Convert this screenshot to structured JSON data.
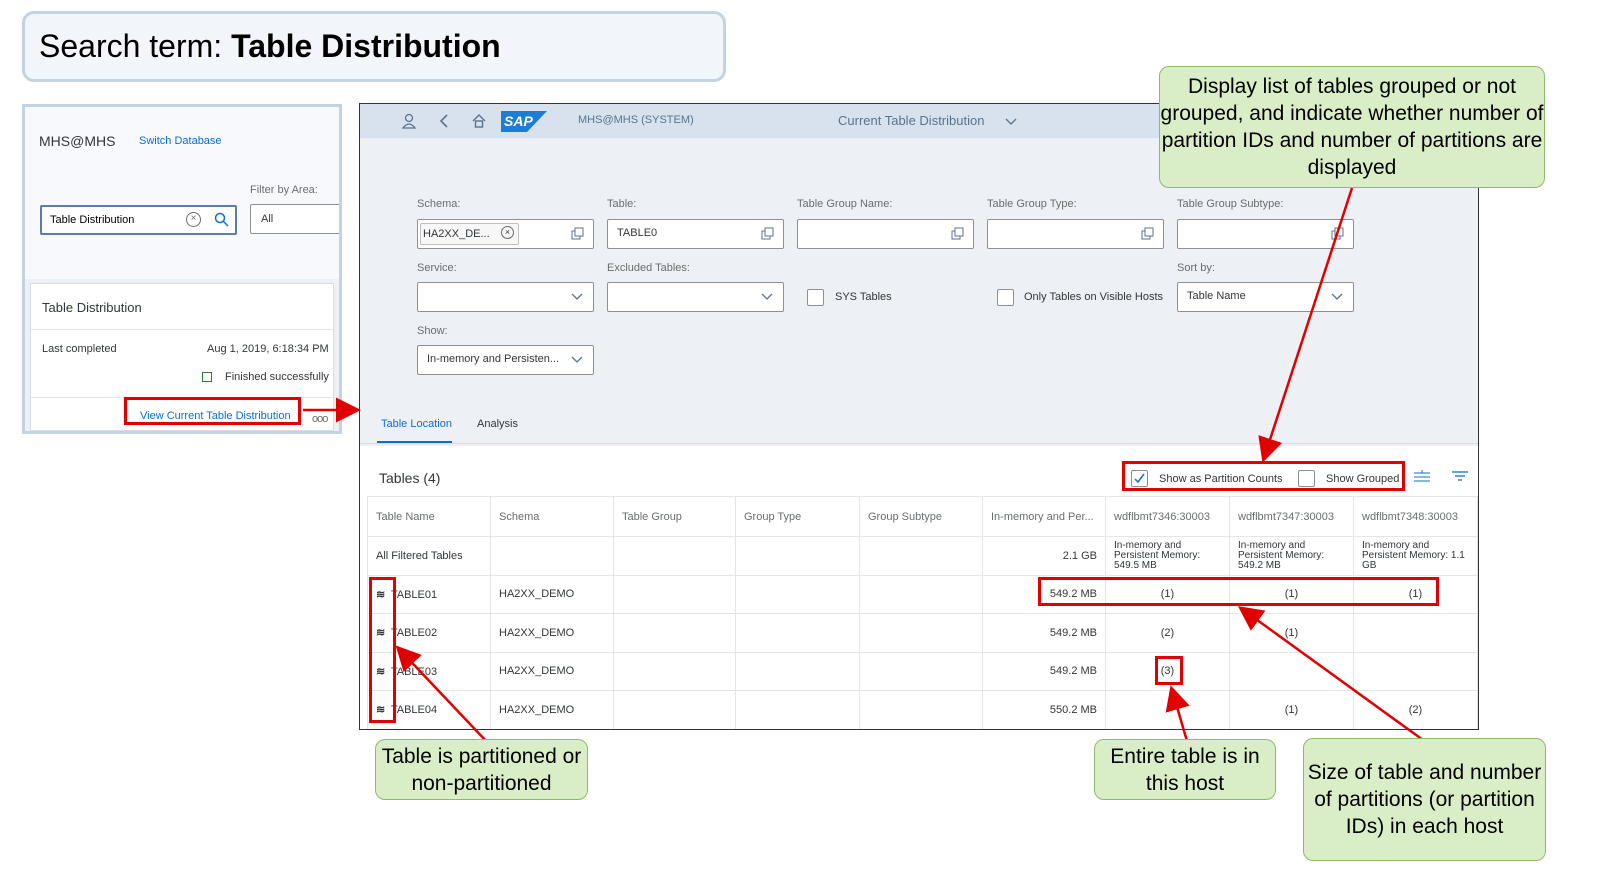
{
  "banner": {
    "prefix": "Search term:",
    "term": "Table Distribution"
  },
  "left_panel": {
    "db_name": "MHS@MHS",
    "switch_db": "Switch Database",
    "filter_label": "Filter by Area:",
    "search_value": "Table Distribution",
    "filter_value": "All",
    "card_title": "Table Distribution",
    "last_completed_label": "Last completed",
    "last_completed_value": "Aug 1, 2019, 6:18:34 PM",
    "status": "Finished successfully",
    "view_link": "View Current Table Distribution",
    "more": "ooo"
  },
  "shell": {
    "logo": "SAP",
    "system": "MHS@MHS (SYSTEM)",
    "title": "Current Table Distribution"
  },
  "filters": {
    "schema_label": "Schema:",
    "schema_token": "HA2XX_DE...",
    "table_label": "Table:",
    "table_value": "TABLE0",
    "group_name_label": "Table Group Name:",
    "group_type_label": "Table Group Type:",
    "group_subtype_label": "Table Group Subtype:",
    "service_label": "Service:",
    "excluded_label": "Excluded Tables:",
    "sys_tables": "SYS Tables",
    "only_visible": "Only Tables on Visible Hosts",
    "sort_label": "Sort by:",
    "sort_value": "Table Name",
    "show_label": "Show:",
    "show_value": "In-memory and Persisten..."
  },
  "tabs": [
    "Table Location",
    "Analysis"
  ],
  "table": {
    "title": "Tables (4)",
    "show_partition_counts": "Show as Partition Counts",
    "show_grouped": "Show Grouped",
    "columns": [
      "Table Name",
      "Schema",
      "Table Group",
      "Group Type",
      "Group Subtype",
      "In-memory and Per...",
      "wdflbmt7346:30003",
      "wdflbmt7347:30003",
      "wdflbmt7348:30003"
    ],
    "summary": {
      "name": "All Filtered Tables",
      "total": "2.1 GB",
      "host1": "In-memory and Persistent Memory: 549.5 MB",
      "host2": "In-memory and Persistent Memory: 549.2 MB",
      "host3": "In-memory and Persistent Memory: 1.1 GB"
    },
    "rows": [
      {
        "name": "TABLE01",
        "schema": "HA2XX_DEMO",
        "size": "549.2 MB",
        "h1": "(1)",
        "h2": "(1)",
        "h3": "(1)"
      },
      {
        "name": "TABLE02",
        "schema": "HA2XX_DEMO",
        "size": "549.2 MB",
        "h1": "(2)",
        "h2": "(1)",
        "h3": ""
      },
      {
        "name": "TABLE03",
        "schema": "HA2XX_DEMO",
        "size": "549.2 MB",
        "h1": "(3)",
        "h2": "",
        "h3": ""
      },
      {
        "name": "TABLE04",
        "schema": "HA2XX_DEMO",
        "size": "550.2 MB",
        "h1": "",
        "h2": "(1)",
        "h3": "(2)"
      }
    ]
  },
  "callouts": {
    "display_list": "Display list of tables grouped or not grouped, and indicate whether number of partition IDs and number of partitions are displayed",
    "partitioned": "Table is partitioned or non-partitioned",
    "entire_table": "Entire table is in this host",
    "size_partitions": "Size of table and number of partitions (or partition IDs) in each host"
  },
  "colors": {
    "accent": "#0a6ed1",
    "callout_bg": "#d9eec7",
    "highlight": "#e00000",
    "shell": "#d8e2ee"
  }
}
